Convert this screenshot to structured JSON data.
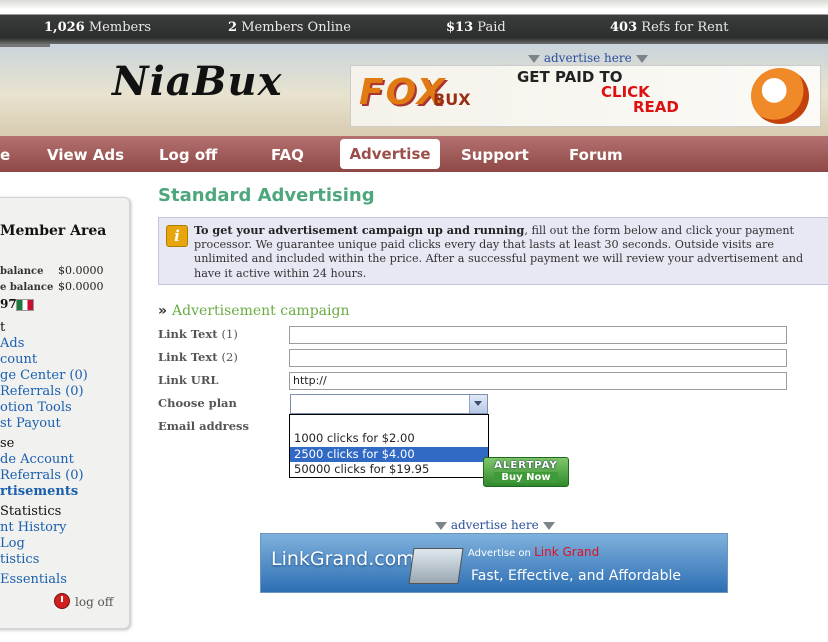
{
  "stats": {
    "members_num": "1,026",
    "members_label": "Members",
    "online_num": "2",
    "online_label": "Members Online",
    "paid_num": "$13",
    "paid_label": "Paid",
    "refs_num": "403",
    "refs_label": "Refs for Rent"
  },
  "header": {
    "logo": "NiaBux",
    "advertise_here": "advertise here",
    "banner": {
      "logo": "FOX",
      "bux": "BUX",
      "line1": "GET PAID TO",
      "line2": "CLICK",
      "line3": "READ"
    }
  },
  "nav": {
    "items": [
      "e",
      "View Ads",
      "Log off",
      "FAQ",
      "Advertise",
      "Support",
      "Forum"
    ],
    "active": "Advertise"
  },
  "sidebar": {
    "member_area": "Member Area",
    "balance_label": "balance",
    "balance_value": "$0.0000",
    "purchase_balance_label": "e balance",
    "purchase_balance_value": "$0.0000",
    "id_fragment": "97",
    "links": [
      {
        "text": "t",
        "style": "dark"
      },
      {
        "text": "Ads",
        "style": "blue"
      },
      {
        "text": "count",
        "style": "blue"
      },
      {
        "text": "ge Center (0)",
        "style": "blue"
      },
      {
        "text": "Referrals (0)",
        "style": "blue"
      },
      {
        "text": "otion Tools",
        "style": "blue"
      },
      {
        "text": "st Payout",
        "style": "blue"
      },
      {
        "text": "se",
        "style": "dark"
      },
      {
        "text": "de Account",
        "style": "blue"
      },
      {
        "text": "Referrals (0)",
        "style": "blue"
      },
      {
        "text": "rtisements",
        "style": "bold"
      },
      {
        "text": "Statistics",
        "style": "dark"
      },
      {
        "text": "nt History",
        "style": "blue"
      },
      {
        "text": "Log",
        "style": "blue"
      },
      {
        "text": "tistics",
        "style": "blue"
      },
      {
        "text": "Essentials",
        "style": "blue"
      }
    ],
    "logoff": "log off"
  },
  "content": {
    "title": "Standard Advertising",
    "info_bold": "To get your advertisement campaign up and running",
    "info_rest": ", fill out the form below and click your payment processor. We guarantee unique paid clicks every day that lasts at least 30 seconds. Outside visits are unlimited and included within the price. After a successful payment we will review your advertisement and have it active within 24 hours.",
    "campaign_heading": "Advertisement campaign",
    "form": {
      "link_text1_label": "Link Text",
      "link_text1_num": "(1)",
      "link_text2_label": "Link Text",
      "link_text2_num": "(2)",
      "link_url_label": "Link URL",
      "link_url_value": "http://",
      "choose_plan_label": "Choose plan",
      "email_label": "Email address",
      "plan_options": [
        "1000 clicks for $2.00",
        "2500 clicks for $4.00",
        "50000 clicks for $19.95"
      ],
      "plan_selected_index": 1
    },
    "alertpay": {
      "top": "ALERTPAY",
      "bottom": "Buy Now"
    },
    "advertise_here": "advertise here",
    "linkgrand": {
      "logo": "LinkGrand.com",
      "advertise_on": "Advertise on",
      "brand": "Link Grand",
      "tagline": "Fast, Effective, and Affordable"
    }
  }
}
